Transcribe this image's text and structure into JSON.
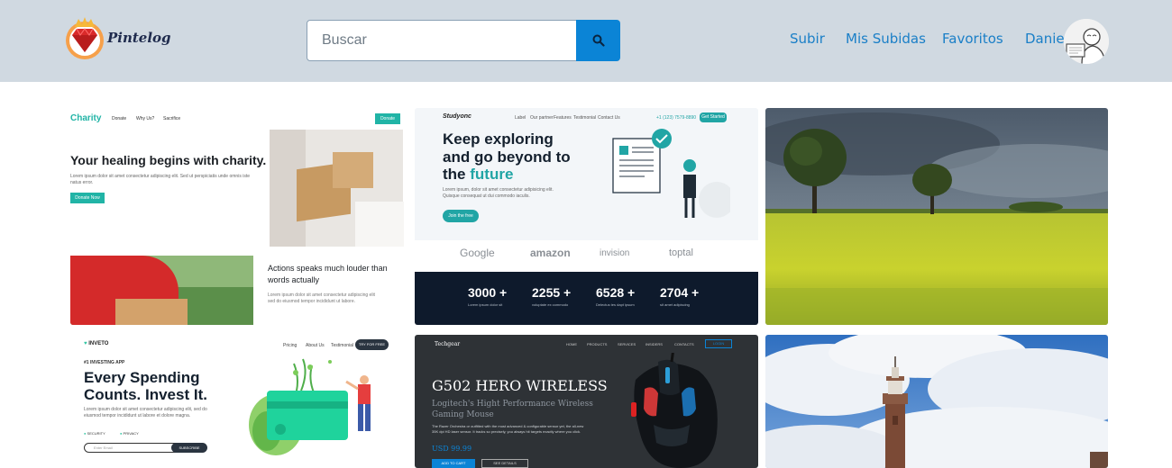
{
  "header": {
    "logo_text": "Pintelog",
    "search": {
      "placeholder": "Buscar",
      "value": ""
    },
    "nav": {
      "upload": "Subir",
      "my_uploads": "Mis Subidas",
      "favorites": "Favoritos",
      "user": "Daniel"
    }
  },
  "cards": {
    "charity": {
      "brand": "Charity",
      "menu": [
        "Donate",
        "Why Us?",
        "Sacrifice"
      ],
      "cta_top": "Donate",
      "headline": "Your healing begins with charity.",
      "body": "Lorem ipsum dolor sit amet consectetur adipiscing elit. Sed ut perspiciatis unde omnis iste natus error.",
      "button": "Donate Now",
      "subhead": "Actions speaks much louder than words actually",
      "subbody": "Lorem ipsum dolor sit amet consectetur adipiscing elit sed do eiusmod tempor incididunt ut labore."
    },
    "study": {
      "brand": "Studyonc",
      "menu": [
        "Label",
        "Our partner",
        "Features",
        "Testimonial",
        "Contact Us"
      ],
      "phone": "+1 (123) 7579-8890",
      "cta_top": "Get Started",
      "headline1": "Keep exploring",
      "headline2": "and go beyond to",
      "headline3_plain": "the ",
      "headline3_accent": "future",
      "body": "Lorem ipsum, dolor sit amet consectetur adipisicing elit. Quisque consequat ut dui commodo iaculis.",
      "button": "Join the free",
      "logos": [
        "Google",
        "amazon",
        "invision",
        "toptal"
      ],
      "stats": [
        {
          "value": "3000 +",
          "label": "Lorem ipsum dolor sit"
        },
        {
          "value": "2255 +",
          "label": "voluptate ex commodo"
        },
        {
          "value": "6528 +",
          "label": "Delectus tes dapt ipsum"
        },
        {
          "value": "2704 +",
          "label": "sit amet adipiscing"
        }
      ]
    },
    "invest": {
      "brand": "INVETO",
      "menu": [
        "Pricing",
        "About Us",
        "Testimonial"
      ],
      "cta_top": "TRY FOR FREE",
      "kicker": "#1 INVESTING APP",
      "headline1": "Every Spending",
      "headline2": "Counts. Invest It.",
      "body": "Lorem ipsum dolor sit amet consectetur adipiscing elit, sed do eiusmod tempor incididunt ut labore et dolore magna.",
      "badges": [
        "SECURITY",
        "PRIVACY"
      ],
      "email_placeholder": "Enter Email",
      "subscribe": "SUBSCRIBE"
    },
    "mouse": {
      "brand": "Techgear",
      "menu": [
        "HOME",
        "PRODUCTS",
        "SERVICES",
        "INSIDERS",
        "CONTACTS"
      ],
      "cta_top": "LOGIN",
      "headline": "G502 HERO WIRELESS",
      "subhead1": "Logitech's Hight Performance Wireless",
      "subhead2": "Gaming Mouse",
      "body": "The Razer Orchestra or outfitted with the most advanced & configurable sensor yet, the all-new 35K dpi HD laser sensor. It tracks so precisely, you always hit targets exactly where you click.",
      "price": "USD 99.99",
      "button1": "ADD TO CART",
      "button2": "SEE DETAILS"
    }
  },
  "colors": {
    "header_bg": "#d0d9e1",
    "accent_blue": "#0b84d6",
    "nav_text": "#1a7fc7",
    "teal": "#21b4a6",
    "mint": "#2ec4a0"
  },
  "icons": {
    "search": "search-icon",
    "logo": "diamond-crown-icon",
    "avatar": "user-avatar-icon"
  }
}
